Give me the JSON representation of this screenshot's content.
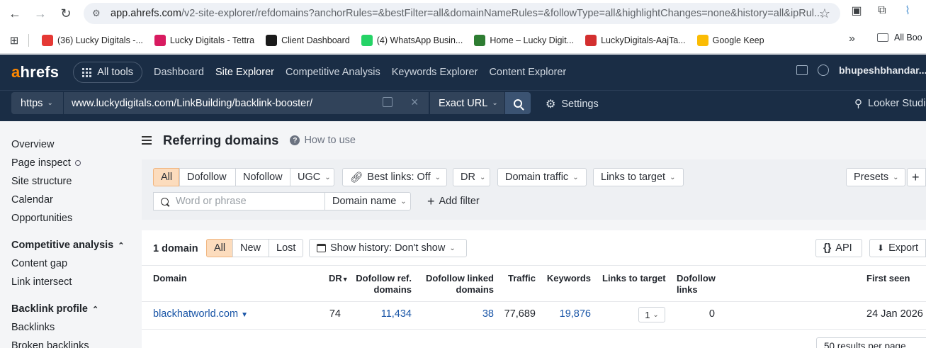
{
  "browser": {
    "url_host": "app.ahrefs.com",
    "url_path": "/v2-site-explorer/refdomains?anchorRules=&bestFilter=all&domainNameRules=&followType=all&highlightChanges=none&history=all&ipRul..."
  },
  "bookmarks": [
    {
      "label": "(36) Lucky Digitals -...",
      "color": "#e53935"
    },
    {
      "label": "Lucky Digitals - Tettra",
      "color": "#d81b60"
    },
    {
      "label": "Client Dashboard",
      "color": "#1b1b1b"
    },
    {
      "label": "(4) WhatsApp Busin...",
      "color": "#25d366"
    },
    {
      "label": "Home – Lucky Digit...",
      "color": "#2e7d32"
    },
    {
      "label": "LuckyDigitals-AajTa...",
      "color": "#d32f2f"
    },
    {
      "label": "Google Keep",
      "color": "#fbbc04"
    }
  ],
  "bookmarks_more": "»",
  "bookmarks_all": "All Boo",
  "header": {
    "logo_a": "a",
    "logo_rest": "hrefs",
    "all_tools": "All tools",
    "nav": [
      "Dashboard",
      "Site Explorer",
      "Competitive Analysis",
      "Keywords Explorer",
      "Content Explorer"
    ],
    "active_nav": "Site Explorer",
    "user": "bhupeshbhandar..."
  },
  "target": {
    "protocol": "https",
    "url": "www.luckydigitals.com/LinkBuilding/backlink-booster/",
    "mode": "Exact URL",
    "settings": "Settings",
    "looker": "Looker Studi"
  },
  "sidebar": {
    "top_items": [
      "Overview",
      "Page inspect",
      "Site structure",
      "Calendar",
      "Opportunities"
    ],
    "section1": "Competitive analysis",
    "section1_items": [
      "Content gap",
      "Link intersect"
    ],
    "section2": "Backlink profile",
    "section2_items": [
      "Backlinks",
      "Broken backlinks"
    ]
  },
  "page": {
    "title": "Referring domains",
    "help": "How to use"
  },
  "filters": {
    "follow_tabs": [
      "All",
      "Dofollow",
      "Nofollow",
      "UGC"
    ],
    "best_links": "Best links: Off",
    "dr": "DR",
    "domain_traffic": "Domain traffic",
    "links_to_target": "Links to target",
    "presets": "Presets",
    "plus": "+",
    "search_placeholder": "Word or phrase",
    "domain_name": "Domain name",
    "add_filter": "Add filter"
  },
  "results": {
    "count": "1 domain",
    "tabs": [
      "All",
      "New",
      "Lost"
    ],
    "history": "Show history: Don't show",
    "api": "API",
    "export": "Export",
    "columns": {
      "domain": "Domain",
      "dr": "DR",
      "dofollow_ref_1": "Dofollow ref.",
      "dofollow_ref_2": "domains",
      "dofollow_linked_1": "Dofollow linked",
      "dofollow_linked_2": "domains",
      "traffic": "Traffic",
      "keywords": "Keywords",
      "links_to_target": "Links to target",
      "dofollow_links_1": "Dofollow",
      "dofollow_links_2": "links",
      "first_seen": "First seen"
    },
    "row": {
      "domain": "blackhatworld.com",
      "dr": "74",
      "dofollow_ref_domains": "11,434",
      "dofollow_linked_domains": "38",
      "traffic": "77,689",
      "keywords": "19,876",
      "links_to_target": "1",
      "dofollow_links": "0",
      "first_seen": "24 Jan 2026"
    },
    "per_page": "50 results per page"
  }
}
